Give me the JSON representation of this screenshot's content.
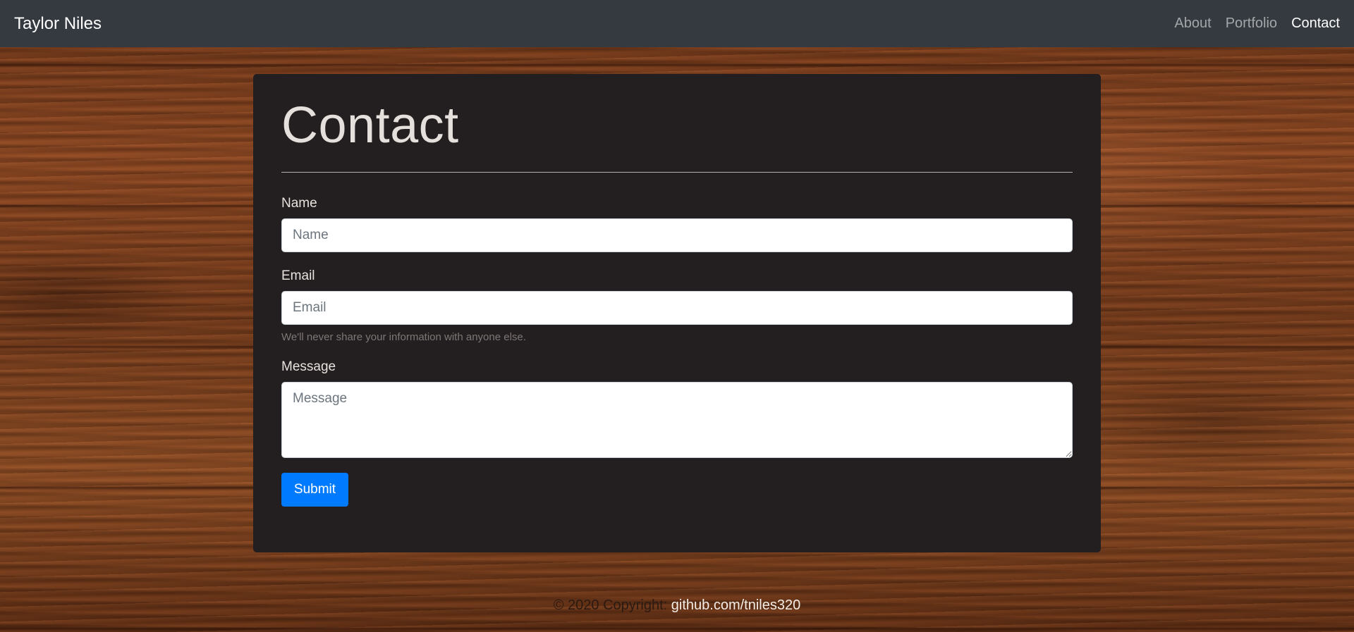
{
  "navbar": {
    "brand": "Taylor Niles",
    "links": [
      {
        "label": "About",
        "active": false
      },
      {
        "label": "Portfolio",
        "active": false
      },
      {
        "label": "Contact",
        "active": true
      }
    ]
  },
  "contact": {
    "title": "Contact",
    "name": {
      "label": "Name",
      "placeholder": "Name",
      "value": ""
    },
    "email": {
      "label": "Email",
      "placeholder": "Email",
      "value": "",
      "help": "We'll never share your information with anyone else."
    },
    "message": {
      "label": "Message",
      "placeholder": "Message",
      "value": ""
    },
    "submit_label": "Submit"
  },
  "footer": {
    "copyright": "© 2020 Copyright:",
    "link_text": "github.com/tniles320"
  },
  "colors": {
    "navbar_bg": "#343a40",
    "card_bg": "#231e1f",
    "primary": "#007bff"
  }
}
